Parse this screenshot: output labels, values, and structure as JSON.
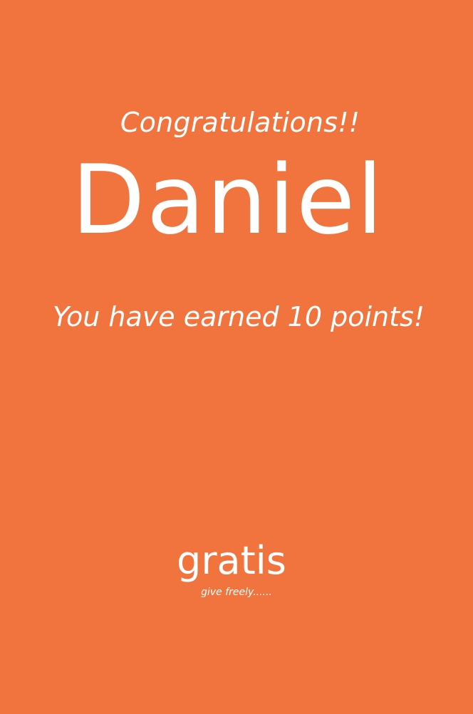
{
  "screen": {
    "background_color": "#F1743E",
    "text_color": "#FFFFFF"
  },
  "message": {
    "heading": "Congratulations!!",
    "recipient_name": "Daniel",
    "points_text": "You have earned 10 points!"
  },
  "branding": {
    "logo_text": "gratis",
    "tagline": "give freely......"
  }
}
